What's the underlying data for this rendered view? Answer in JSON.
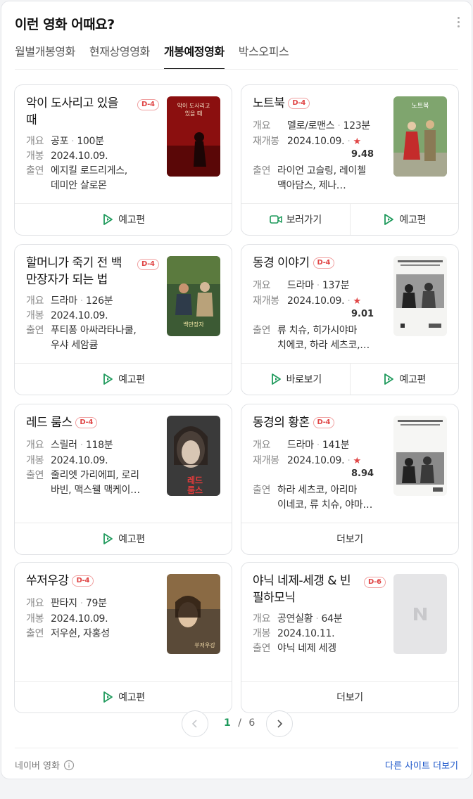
{
  "header": {
    "title": "이런 영화 어때요?"
  },
  "tabs": [
    "월별개봉영화",
    "현재상영영화",
    "개봉예정영화",
    "박스오피스"
  ],
  "active_tab": "개봉예정영화",
  "labels": {
    "genre": "개요",
    "release": "개봉",
    "rerelease": "재개봉",
    "cast": "출연"
  },
  "cards": [
    {
      "title_lines": [
        "악이 도사리고 있을",
        "때"
      ],
      "dday": "D-4",
      "genre": "공포",
      "runtime": "100분",
      "date": "2024.10.09.",
      "cast_lines": [
        "에지킬 로드리게스,",
        "데미안 살로몬"
      ],
      "buttons": [
        "예고편"
      ]
    },
    {
      "title_lines": [
        "노트북"
      ],
      "dday": "D-4",
      "genre": "멜로/로맨스",
      "runtime": "123분",
      "date": "2024.10.09.",
      "star": "★",
      "score": "9.48",
      "cast_lines": [
        "라이언 고슬링, 레이첼",
        "맥아담스, 제나…"
      ],
      "buttons": [
        "보러가기",
        "예고편"
      ]
    },
    {
      "title_lines": [
        "할머니가 죽기 전 백",
        "만장자가 되는 법"
      ],
      "dday": "D-4",
      "genre": "드라마",
      "runtime": "126분",
      "date": "2024.10.09.",
      "cast_lines": [
        "푸티퐁 아싸라타나쿨,",
        "우샤 세암큠"
      ],
      "buttons": [
        "예고편"
      ]
    },
    {
      "title_lines": [
        "동경 이야기"
      ],
      "dday": "D-4",
      "genre": "드라마",
      "runtime": "137분",
      "date": "2024.10.09.",
      "star": "★",
      "score": "9.01",
      "cast_lines": [
        "류 치슈, 히가시야마",
        "치에코, 하라 세츠코,…"
      ],
      "buttons": [
        "바로보기",
        "예고편"
      ]
    },
    {
      "title_lines": [
        "레드 룸스"
      ],
      "dday": "D-4",
      "genre": "스릴러",
      "runtime": "118분",
      "date": "2024.10.09.",
      "cast_lines": [
        "줄리엣 가리에피, 로리",
        "바빈, 맥스웰 맥케이…"
      ],
      "buttons": [
        "예고편"
      ]
    },
    {
      "title_lines": [
        "동경의 황혼"
      ],
      "dday": "D-4",
      "genre": "드라마",
      "runtime": "141분",
      "date": "2024.10.09.",
      "star": "★",
      "score": "8.94",
      "cast_lines": [
        "하라 세츠코, 아리마",
        "이네코, 류 치슈, 야마…"
      ],
      "buttons": [
        "더보기"
      ]
    },
    {
      "title_lines": [
        "쑤저우강"
      ],
      "dday": "D-4",
      "genre": "판타지",
      "runtime": "79분",
      "date": "2024.10.09.",
      "cast_lines": [
        "저우쉰, 자홍성"
      ],
      "buttons": [
        "예고편"
      ]
    },
    {
      "title_lines": [
        "야닉 네제-세갱 & 빈",
        "필하모닉"
      ],
      "dday": "D-6",
      "genre": "공연실황",
      "runtime": "64분",
      "date": "2024.10.11.",
      "cast_lines": [
        "야닉 네제 세겡"
      ],
      "buttons": [
        "더보기"
      ]
    }
  ],
  "pagination": {
    "current": "1",
    "separator": "/",
    "total": "6"
  },
  "footer": {
    "source": "네이버 영화",
    "more_link": "다른 사이트 더보기"
  },
  "colors": {
    "accent_green": "#1f9a5c",
    "dday_red": "#e04545",
    "link_blue": "#1a55c9"
  }
}
